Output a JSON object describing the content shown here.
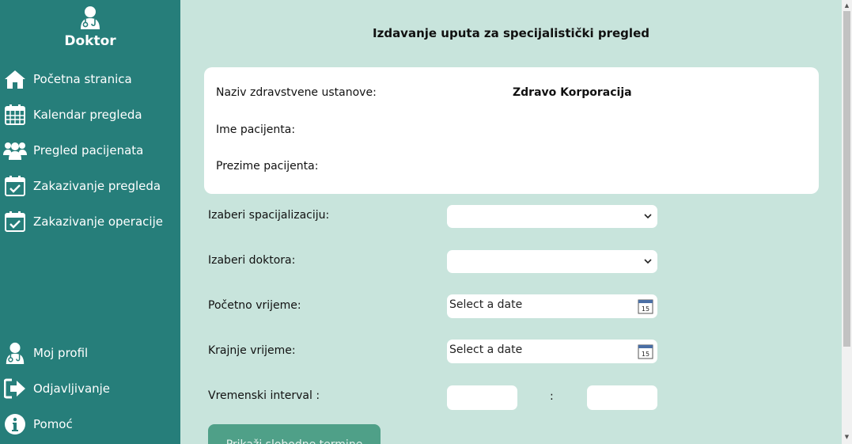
{
  "sidebar": {
    "brand_title": "Doktor",
    "items": [
      {
        "label": "Početna stranica",
        "icon": "home-icon"
      },
      {
        "label": "Kalendar pregleda",
        "icon": "calendar-icon"
      },
      {
        "label": "Pregled pacijenata",
        "icon": "users-icon"
      },
      {
        "label": "Zakazivanje pregleda",
        "icon": "calendar-check-icon"
      },
      {
        "label": "Zakazivanje operacije",
        "icon": "calendar-check-icon"
      }
    ],
    "bottom_items": [
      {
        "label": "Moj profil",
        "icon": "doctor-icon"
      },
      {
        "label": "Odjavljivanje",
        "icon": "sign-out-icon"
      },
      {
        "label": "Pomoć",
        "icon": "info-icon"
      }
    ],
    "color": "#267e7a"
  },
  "main": {
    "title": "Izdavanje uputa za specijalistički pregled",
    "info": {
      "institution_label": "Naziv zdravstvene ustanove:",
      "institution_value": "Zdravo Korporacija",
      "first_name_label": "Ime pacijenta:",
      "last_name_label": "Prezime pacijenta:"
    },
    "form": {
      "specialization_label": "Izaberi spacijalizaciju:",
      "doctor_label": "Izaberi doktora:",
      "start_label": "Početno vrijeme:",
      "start_placeholder": "Select a date",
      "end_label": "Krajnje vrijeme:",
      "end_placeholder": "Select a date",
      "interval_label": "Vremenski interval :",
      "interval_separator": ":"
    },
    "show_button": "Prikaži slobodne termine",
    "background": "#c8e4dc",
    "button_color": "#4fa088"
  }
}
